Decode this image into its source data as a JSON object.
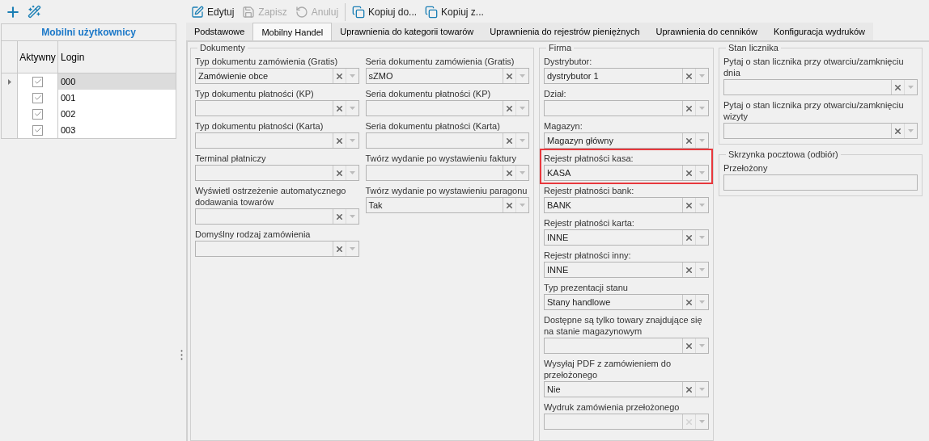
{
  "users_grid": {
    "title": "Mobilni użytkownicy",
    "columns": [
      "Aktywny",
      "Login"
    ],
    "rows": [
      {
        "active": true,
        "login": "000",
        "selected": true
      },
      {
        "active": true,
        "login": "001",
        "selected": false
      },
      {
        "active": true,
        "login": "002",
        "selected": false
      },
      {
        "active": true,
        "login": "003",
        "selected": false
      }
    ]
  },
  "toolbar": [
    {
      "kind": "edit",
      "label": "Edytuj",
      "disabled": false
    },
    {
      "kind": "save",
      "label": "Zapisz",
      "disabled": true
    },
    {
      "kind": "cancel",
      "label": "Anuluj",
      "disabled": true
    },
    {
      "kind": "copy_to",
      "label": "Kopiuj do..."
    },
    {
      "kind": "copy_from",
      "label": "Kopiuj z..."
    }
  ],
  "tabs": [
    {
      "label": "Podstawowe",
      "selected": false
    },
    {
      "label": "Mobilny Handel",
      "selected": true
    },
    {
      "label": "Uprawnienia do kategorii towarów",
      "selected": false
    },
    {
      "label": "Uprawnienia do rejestrów pieniężnych",
      "selected": false
    },
    {
      "label": "Uprawnienia do cenników",
      "selected": false
    },
    {
      "label": "Konfiguracja wydruków",
      "selected": false
    }
  ],
  "dokumenty": {
    "title": "Dokumenty",
    "columns": [
      [
        {
          "label": "Typ dokumentu zamówienia (Gratis)",
          "value": "Zamówienie obce"
        },
        {
          "label": "Typ dokumentu płatności (KP)"
        },
        {
          "label": "Typ dokumentu płatności (Karta)"
        },
        {
          "label": "Terminal płatniczy"
        },
        {
          "label": "Wyświetl ostrzeżenie automatycznego dodawania towarów"
        },
        {
          "label": "Domyślny rodzaj zamówienia"
        }
      ],
      [
        {
          "label": "Seria dokumentu zamówienia (Gratis)",
          "value": "sZMO"
        },
        {
          "label": "Seria dokumentu płatności (KP)"
        },
        {
          "label": "Seria dokumentu płatności (Karta)"
        },
        {
          "label": "Twórz wydanie po wystawieniu faktury"
        },
        {
          "label": "Twórz wydanie po wystawieniu paragonu",
          "value": "Tak"
        }
      ]
    ]
  },
  "firma": {
    "title": "Firma",
    "fields": [
      {
        "label": "Dystrybutor:",
        "value": "dystrybutor 1",
        "highlighted": false,
        "clear_disabled": false
      },
      {
        "label": "Dział:",
        "highlighted": false,
        "clear_disabled": false
      },
      {
        "label": "Magazyn:",
        "value": "Magazyn główny",
        "highlighted": false,
        "clear_disabled": false
      },
      {
        "label": "Rejestr płatności kasa:",
        "value": "KASA",
        "highlighted": true,
        "clear_disabled": false
      },
      {
        "label": "Rejestr płatności bank:",
        "value": "BANK",
        "highlighted": false,
        "clear_disabled": false
      },
      {
        "label": "Rejestr płatności karta:",
        "value": "INNE",
        "highlighted": false,
        "clear_disabled": false
      },
      {
        "label": "Rejestr płatności inny:",
        "value": "INNE",
        "highlighted": false,
        "clear_disabled": false
      },
      {
        "label": "Typ prezentacji stanu",
        "value": "Stany handlowe",
        "highlighted": false,
        "clear_disabled": false
      },
      {
        "label": "Dostępne są tylko towary znajdujące się na stanie magazynowym",
        "highlighted": false,
        "clear_disabled": false
      },
      {
        "label": "Wysyłaj PDF z zamówieniem do przełożonego",
        "value": "Nie",
        "highlighted": false,
        "clear_disabled": false
      },
      {
        "label": "Wydruk zamówienia przełożonego",
        "highlighted": false,
        "clear_disabled": true
      }
    ]
  },
  "stan_licznika": {
    "title": "Stan licznika",
    "fields": [
      {
        "label": "Pytaj o stan licznika przy otwarciu/zamknięciu dnia"
      },
      {
        "label": "Pytaj o stan licznika przy otwarciu/zamknięciu wizyty"
      }
    ]
  },
  "skrzynka": {
    "title": "Skrzynka pocztowa (odbiór)",
    "fields": [
      {
        "kind": "text",
        "label": "Przełożony"
      }
    ]
  }
}
